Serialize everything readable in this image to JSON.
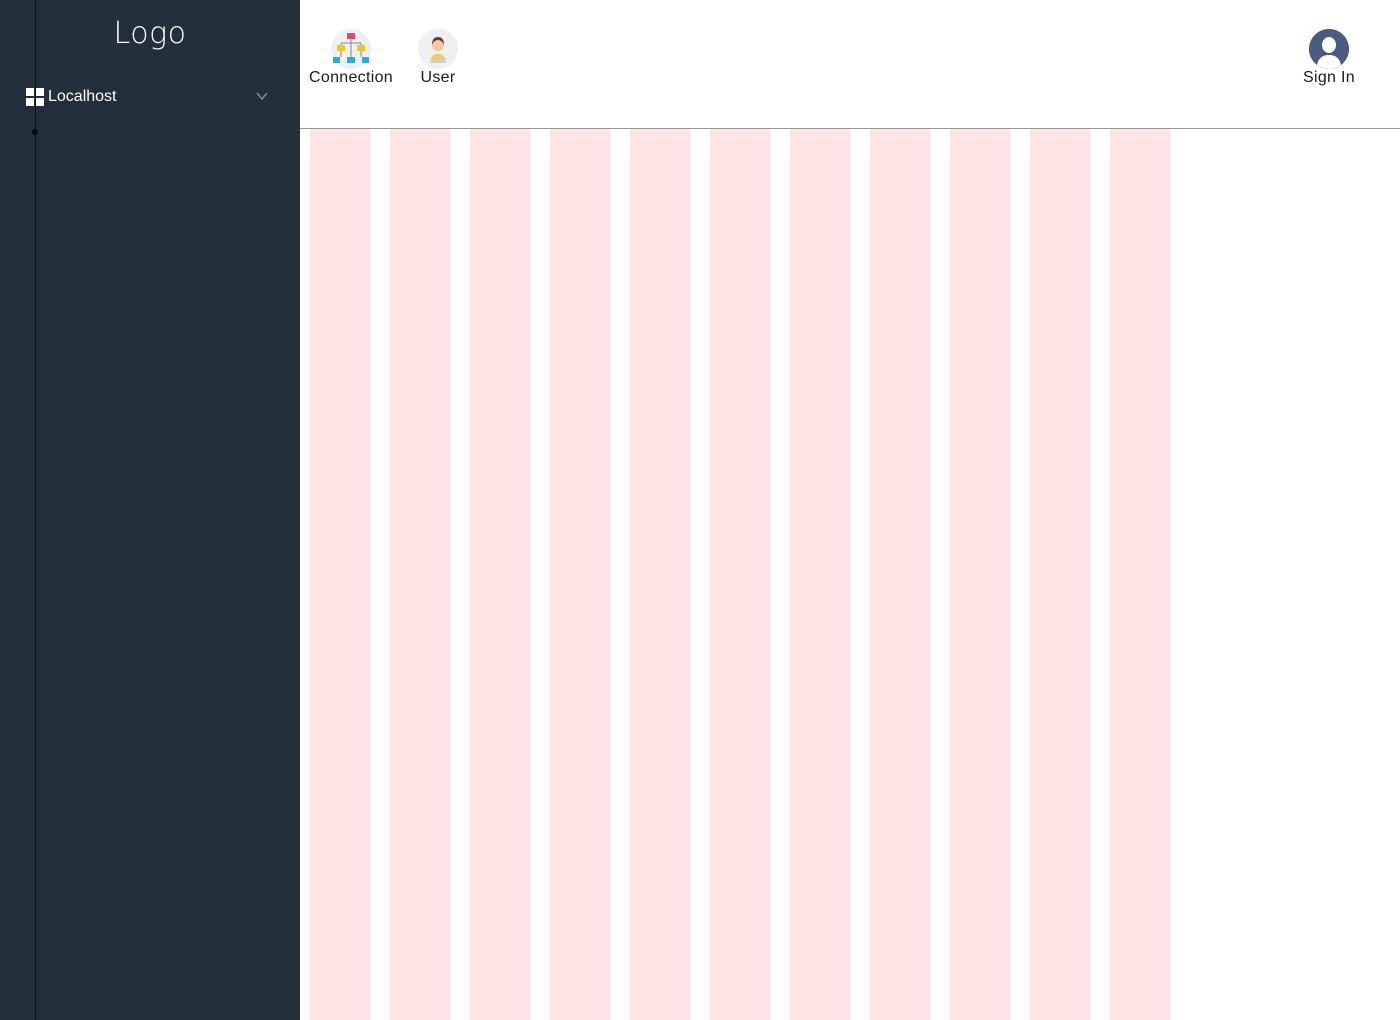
{
  "sidebar": {
    "logo": "Logo",
    "items": [
      {
        "label": "Localhost",
        "icon": "grid-icon",
        "expand_icon": "chevron-down-icon"
      }
    ],
    "background": "#232f3a"
  },
  "header": {
    "tools": [
      {
        "label": "Connection",
        "icon": "network-hierarchy-icon"
      },
      {
        "label": "User",
        "icon": "user-avatar-icon"
      }
    ],
    "account": {
      "label": "Sign In",
      "icon": "profile-silhouette-icon"
    }
  },
  "layout_grid": {
    "column_count": 11,
    "column_color": "#fee4e4"
  }
}
